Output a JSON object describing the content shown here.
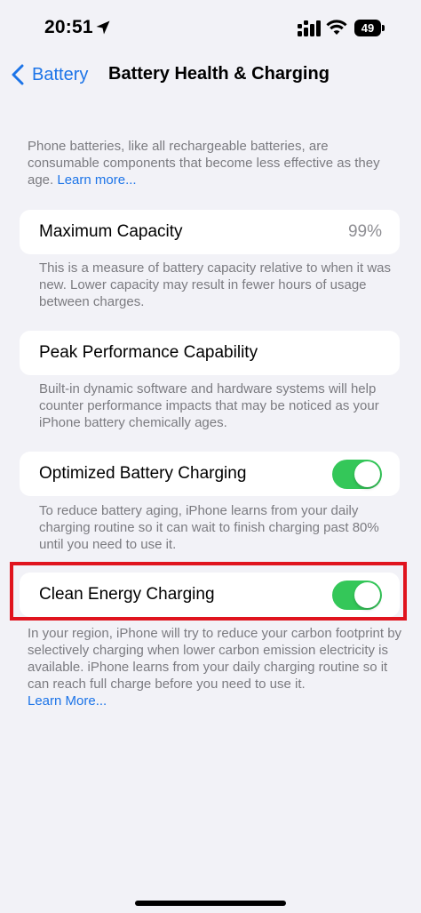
{
  "status_bar": {
    "time": "20:51",
    "battery_level": "49",
    "icons": [
      "location-arrow-icon",
      "signal-icon",
      "wifi-icon",
      "battery-icon"
    ]
  },
  "nav": {
    "back_label": "Battery",
    "title": "Battery Health & Charging"
  },
  "intro": {
    "text": "Phone batteries, like all rechargeable batteries, are consumable components that become less effective as they age.",
    "link": "Learn more..."
  },
  "max_capacity": {
    "label": "Maximum Capacity",
    "value": "99%",
    "description": "This is a measure of battery capacity relative to when it was new. Lower capacity may result in fewer hours of usage between charges."
  },
  "peak_performance": {
    "label": "Peak Performance Capability",
    "description": "Built-in dynamic software and hardware systems will help counter performance impacts that may be noticed as your iPhone battery chemically ages."
  },
  "optimized_charging": {
    "label": "Optimized Battery Charging",
    "enabled": true,
    "description": "To reduce battery aging, iPhone learns from your daily charging routine so it can wait to finish charging past 80% until you need to use it."
  },
  "clean_energy": {
    "label": "Clean Energy Charging",
    "enabled": true,
    "description": "In your region, iPhone will try to reduce your carbon footprint by selectively charging when lower carbon emission electricity is available. iPhone learns from your daily charging routine so it can reach full charge before you need to use it.",
    "link": "Learn More..."
  },
  "colors": {
    "accent": "#1c74e8",
    "toggle_on": "#34c759",
    "highlight": "#e0141e",
    "background": "#f2f2f7"
  }
}
